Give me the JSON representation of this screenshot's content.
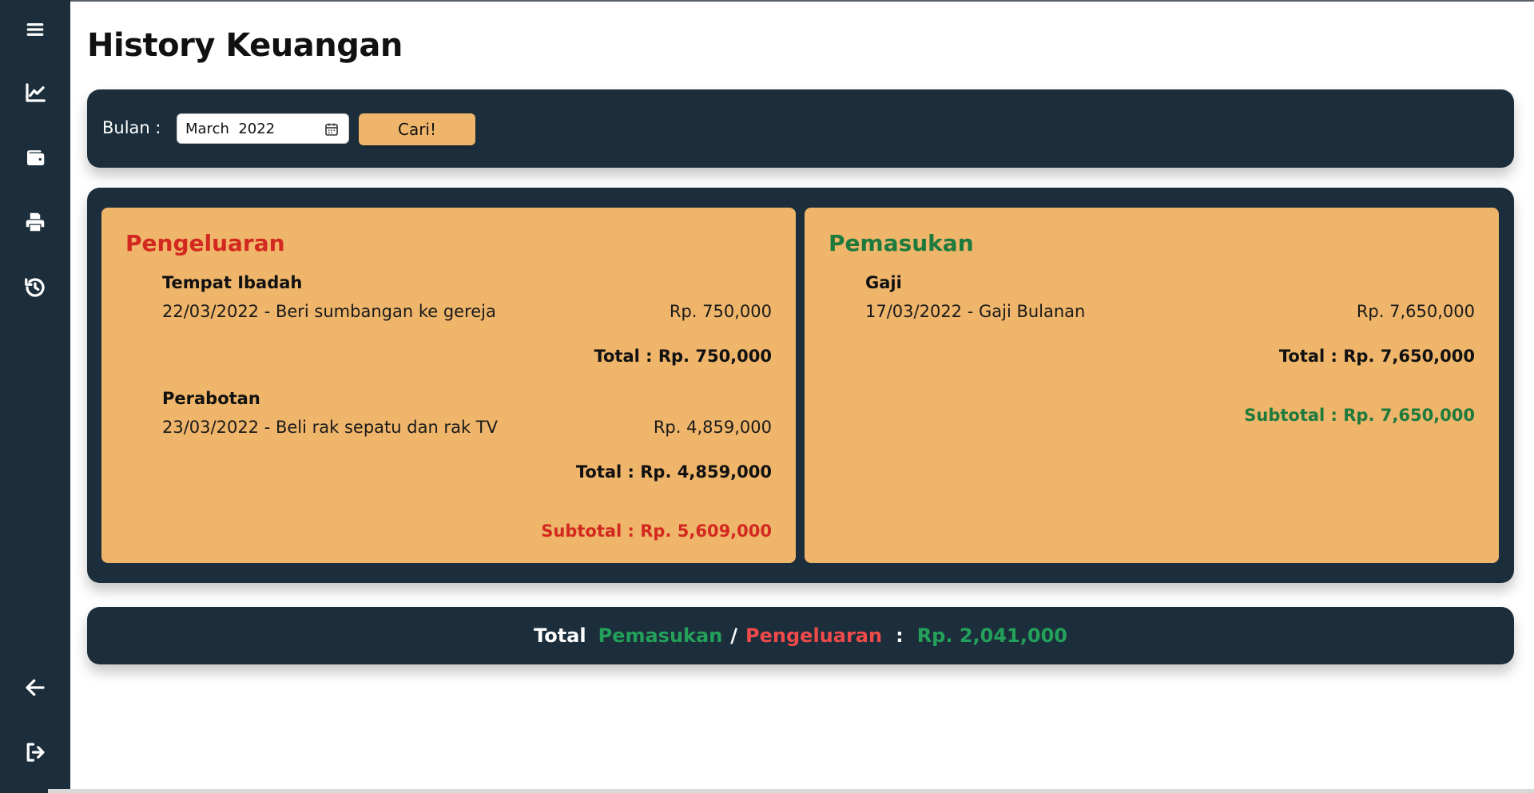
{
  "page": {
    "title": "History Keuangan"
  },
  "sidebar": {
    "icons": [
      "menu-icon",
      "chart-line-icon",
      "wallet-icon",
      "printer-icon",
      "history-icon",
      "arrow-left-icon",
      "sign-out-icon"
    ]
  },
  "filter": {
    "label": "Bulan :",
    "month_value": "March  2022",
    "button_label": "Cari!"
  },
  "pengeluaran": {
    "title": "Pengeluaran",
    "groups": [
      {
        "name": "Tempat Ibadah",
        "entries": [
          {
            "desc": "22/03/2022 - Beri sumbangan ke gereja",
            "amount": "Rp. 750,000"
          }
        ],
        "total": "Total : Rp. 750,000"
      },
      {
        "name": "Perabotan",
        "entries": [
          {
            "desc": "23/03/2022 - Beli rak sepatu dan rak TV",
            "amount": "Rp. 4,859,000"
          }
        ],
        "total": "Total : Rp. 4,859,000"
      }
    ],
    "subtotal": "Subtotal : Rp. 5,609,000"
  },
  "pemasukan": {
    "title": "Pemasukan",
    "groups": [
      {
        "name": "Gaji",
        "entries": [
          {
            "desc": "17/03/2022 - Gaji Bulanan",
            "amount": "Rp. 7,650,000"
          }
        ],
        "total": "Total : Rp. 7,650,000"
      }
    ],
    "subtotal": "Subtotal : Rp. 7,650,000"
  },
  "summary": {
    "label": "Total",
    "income_word": "Pemasukan",
    "separator": "/",
    "expense_word": "Pengeluaran",
    "colon": ":",
    "value": "Rp. 2,041,000"
  },
  "colors": {
    "sidebar": "#1c2e3b",
    "card": "#efb56a",
    "expense_red": "#d3281f",
    "income_green": "#1d7a3c"
  }
}
